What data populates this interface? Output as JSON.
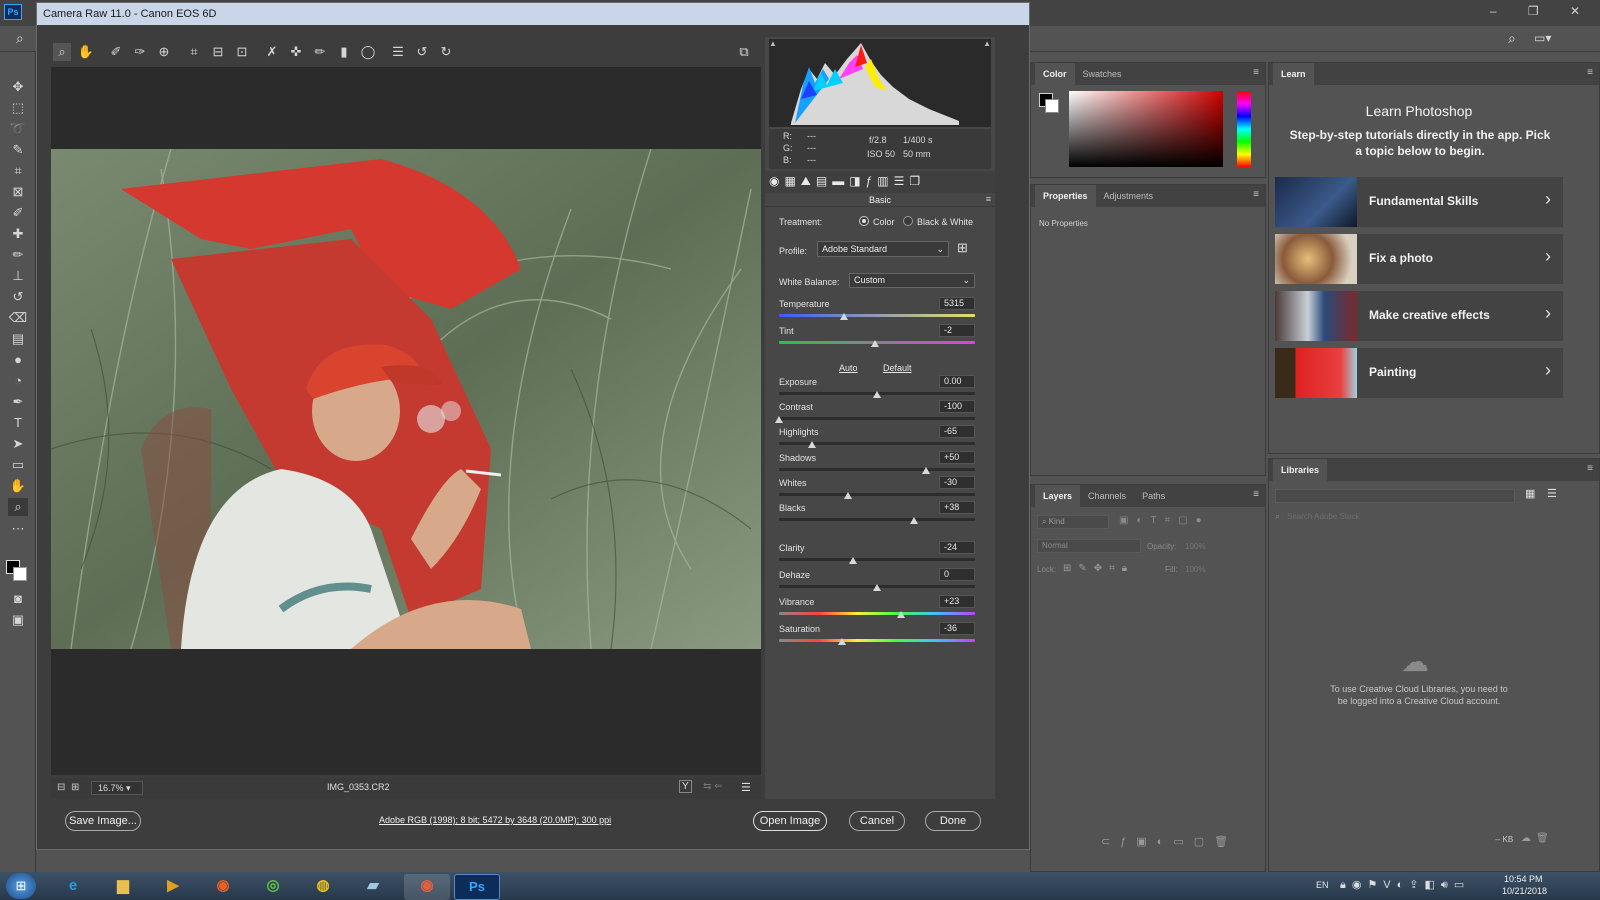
{
  "dialog": {
    "title": "Camera Raw 11.0  -  Canon EOS 6D",
    "filename": "IMG_0353.CR2",
    "zoom": "16.7%",
    "workflow_link": "Adobe RGB (1998); 8 bit; 5472 by 3648 (20.0MP); 300 ppi",
    "save_button": "Save Image...",
    "open_button": "Open Image",
    "cancel_button": "Cancel",
    "done_button": "Done"
  },
  "readout": {
    "r": "R:",
    "g": "G:",
    "b": "B:",
    "dash": "---",
    "aperture": "f/2.8",
    "shutter": "1/400 s",
    "iso": "ISO 50",
    "focal": "50 mm"
  },
  "basic": {
    "section_title": "Basic",
    "treatment_label": "Treatment:",
    "treatment_color": "Color",
    "treatment_bw": "Black & White",
    "profile_label": "Profile:",
    "profile_value": "Adobe Standard",
    "wb_label": "White Balance:",
    "wb_value": "Custom",
    "auto": "Auto",
    "default": "Default"
  },
  "sliders": [
    {
      "name": "Temperature",
      "value": "5315",
      "pos": 0.33
    },
    {
      "name": "Tint",
      "value": "-2",
      "pos": 0.49
    },
    {
      "name": "Exposure",
      "value": "0.00",
      "pos": 0.5
    },
    {
      "name": "Contrast",
      "value": "-100",
      "pos": 0.0
    },
    {
      "name": "Highlights",
      "value": "-65",
      "pos": 0.17
    },
    {
      "name": "Shadows",
      "value": "+50",
      "pos": 0.75
    },
    {
      "name": "Whites",
      "value": "-30",
      "pos": 0.35
    },
    {
      "name": "Blacks",
      "value": "+38",
      "pos": 0.69
    },
    {
      "name": "Clarity",
      "value": "-24",
      "pos": 0.38
    },
    {
      "name": "Dehaze",
      "value": "0",
      "pos": 0.5
    },
    {
      "name": "Vibrance",
      "value": "+23",
      "pos": 0.62
    },
    {
      "name": "Saturation",
      "value": "-36",
      "pos": 0.32
    }
  ],
  "panels": {
    "color_tab": "Color",
    "swatches_tab": "Swatches",
    "properties_tab": "Properties",
    "adjustments_tab": "Adjustments",
    "no_properties": "No Properties",
    "layers_tab": "Layers",
    "channels_tab": "Channels",
    "paths_tab": "Paths",
    "kind": "Kind",
    "blend_mode": "Normal",
    "opacity_label": "Opacity:",
    "opacity_value": "100%",
    "lock_label": "Lock:",
    "fill_label": "Fill:",
    "fill_value": "100%",
    "learn_tab": "Learn",
    "learn_title": "Learn Photoshop",
    "learn_subtitle": "Step-by-step tutorials directly in the app. Pick a topic below to begin.",
    "learn_items": [
      "Fundamental Skills",
      "Fix a photo",
      "Make creative effects",
      "Painting"
    ],
    "libraries_tab": "Libraries",
    "libraries_search": "Search Adobe Stock",
    "libraries_msg": "To use Creative Cloud Libraries, you need to be logged into a Creative Cloud account.",
    "libraries_size": "-- KB"
  },
  "taskbar": {
    "lang": "EN",
    "time": "10:54 PM",
    "date": "10/21/2018",
    "ps": "Ps"
  },
  "ps_logo": "Ps"
}
